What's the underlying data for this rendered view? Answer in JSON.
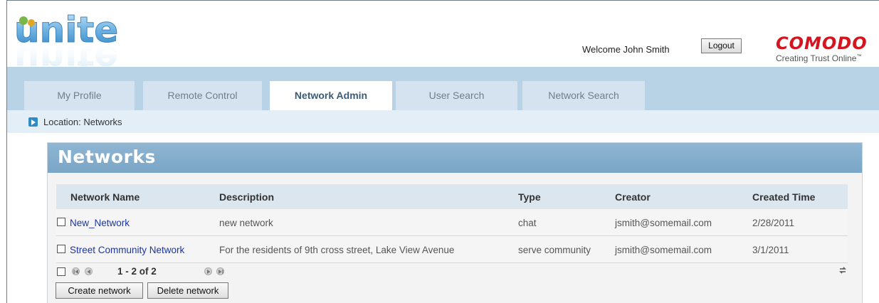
{
  "header": {
    "app_logo": "unite",
    "welcome_text": "Welcome John Smith",
    "logout_label": "Logout",
    "brand_name": "COMODO",
    "brand_tagline": "Creating Trust Online",
    "brand_tm": "™"
  },
  "tabs": [
    {
      "label": "My Profile",
      "active": false
    },
    {
      "label": "Remote Control",
      "active": false
    },
    {
      "label": "Network Admin",
      "active": true
    },
    {
      "label": "User Search",
      "active": false
    },
    {
      "label": "Network Search",
      "active": false
    }
  ],
  "breadcrumb": {
    "icon": "arrow-right-icon",
    "text": "Location: Networks"
  },
  "panel": {
    "title": "Networks",
    "columns": [
      "Network Name",
      "Description",
      "Type",
      "Creator",
      "Created Time"
    ],
    "rows": [
      {
        "name": "New_Network",
        "description": "new network",
        "type": "chat",
        "creator": "jsmith@somemail.com",
        "created": "2/28/2011"
      },
      {
        "name": "Street Community Network",
        "description": "For the residents of 9th cross street, Lake View Avenue",
        "type": "serve community",
        "creator": "jsmith@somemail.com",
        "created": "3/1/2011"
      }
    ],
    "pager_text": "1 - 2 of 2",
    "create_label": "Create network",
    "delete_label": "Delete network"
  },
  "colors": {
    "brand_red": "#d4151f",
    "tabbar": "#b9d3e6",
    "panel_title": "#7aa5c6",
    "link": "#1a35a8"
  }
}
